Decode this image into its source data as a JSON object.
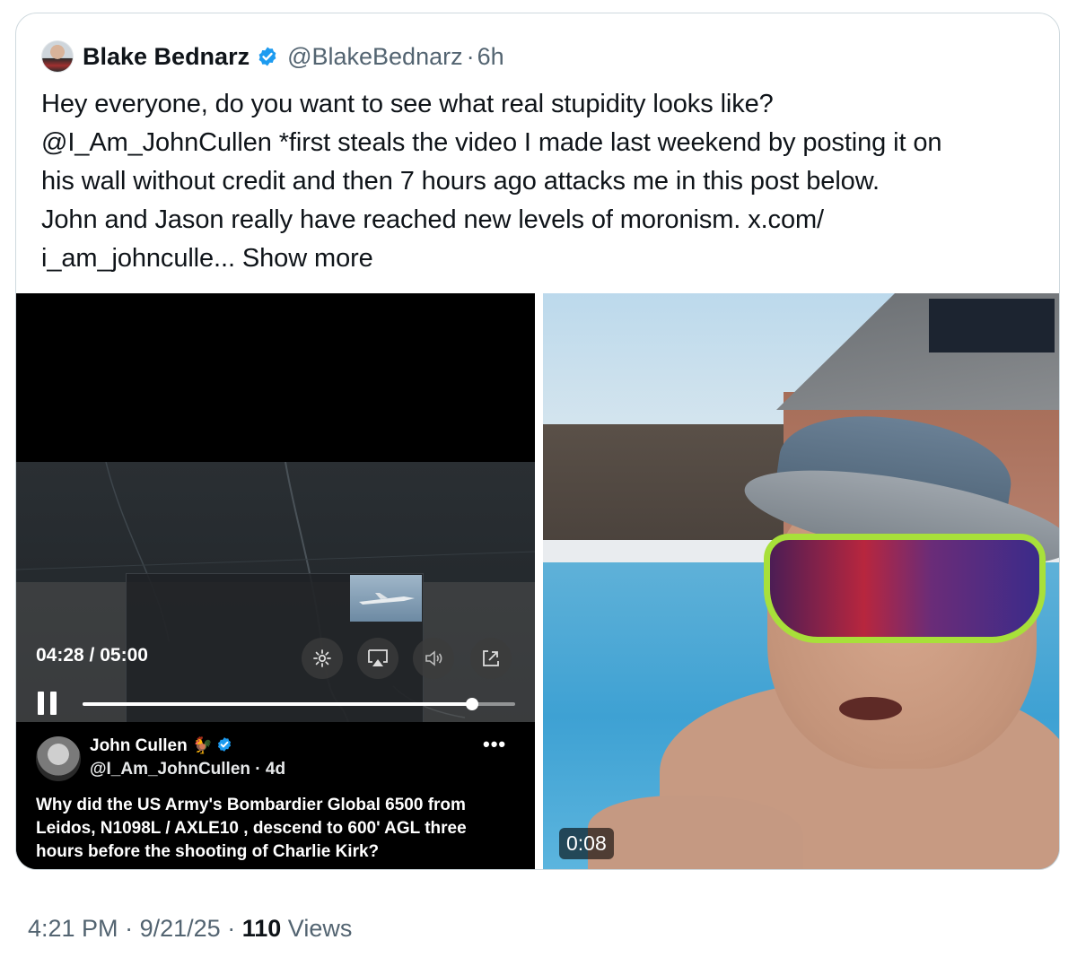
{
  "post": {
    "author_name": "Blake Bednarz",
    "handle": "@BlakeBednarz",
    "separator": "·",
    "age": "6h",
    "text_lines": [
      "Hey everyone, do you want to see what real stupidity looks like?",
      "@I_Am_JohnCullen *first steals the video I made last weekend by posting it on",
      "his wall without credit and then 7 hours ago attacks me in this post below.",
      "John and Jason really have reached new levels of moronism. x.com/"
    ],
    "last_line": "i_am_johnculle...",
    "show_more": "Show more"
  },
  "left_video": {
    "time": "04:28 / 05:00",
    "progress": 0.9,
    "embed": {
      "name": "John Cullen",
      "emoji": "🐓",
      "handle": "@I_Am_JohnCullen",
      "separator": "·",
      "age": "4d",
      "more": "•••",
      "text_lines": [
        "Why did the US Army's Bombardier Global 6500 from",
        "Leidos, N1098L / AXLE10 ,  descend to 600' AGL three",
        "hours before the shooting of Charlie Kirk?"
      ]
    }
  },
  "right_video": {
    "duration": "0:08"
  },
  "footer": {
    "time": "4:21 PM",
    "sep1": "·",
    "date": "9/21/25",
    "sep2": "·",
    "views_count": "110",
    "views_label": "Views"
  },
  "colors": {
    "verified_blue": "#1d9bf0",
    "secondary_text": "#536471",
    "primary_text": "#0f1419"
  }
}
